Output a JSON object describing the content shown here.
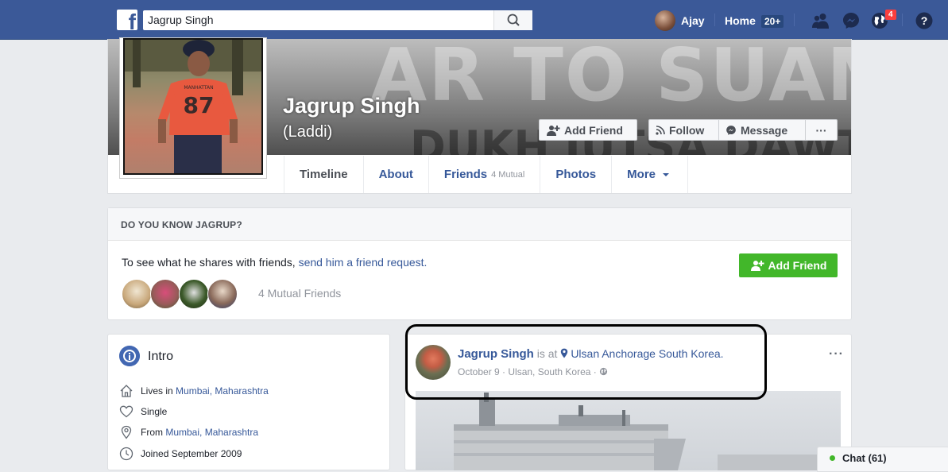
{
  "topbar": {
    "search_value": "Jagrup Singh",
    "user_name": "Ajay",
    "home_label": "Home",
    "home_count": "20+",
    "notification_count": "4"
  },
  "profile": {
    "name": "Jagrup Singh",
    "nickname": "(Laddi)",
    "cover_words": [
      "AR TO SUAMI",
      "DUKH JUTSA DAWT"
    ],
    "shirt_text": "MANHATTAN",
    "shirt_number": "87",
    "actions": {
      "add_friend": "Add Friend",
      "follow": "Follow",
      "message": "Message",
      "more": "···"
    },
    "tabs": [
      {
        "label": "Timeline",
        "extra": ""
      },
      {
        "label": "About",
        "extra": ""
      },
      {
        "label": "Friends",
        "extra": "4 Mutual"
      },
      {
        "label": "Photos",
        "extra": ""
      },
      {
        "label": "More",
        "extra": ""
      }
    ]
  },
  "know": {
    "heading": "DO YOU KNOW JAGRUP?",
    "text": "To see what he shares with friends, ",
    "link": "send him a friend request.",
    "button": "Add Friend",
    "mutual": "4 Mutual Friends"
  },
  "intro": {
    "title": "Intro",
    "lives_prefix": "Lives in ",
    "lives_link": "Mumbai, Maharashtra",
    "relationship": "Single",
    "from_prefix": "From ",
    "from_link": "Mumbai, Maharashtra",
    "joined": "Joined September 2009"
  },
  "post": {
    "author": "Jagrup Singh",
    "is_at": " is at ",
    "location": "Ulsan Anchorage South Korea.",
    "date": "October 9",
    "place": "Ulsan, South Korea",
    "more": "···"
  },
  "chat": {
    "label": "Chat (61)"
  },
  "colors": {
    "brand": "#3b5998",
    "link": "#365899",
    "green": "#42b72a",
    "badge_red": "#fa3e3e"
  },
  "icons": [
    "facebook-logo-icon",
    "search-icon",
    "friends-icon",
    "messenger-icon",
    "globe-icon",
    "help-icon",
    "add-friend-icon",
    "follow-rss-icon",
    "messenger-small-icon",
    "caret-down-icon",
    "intro-globe-icon",
    "home-icon",
    "heart-icon",
    "location-pin-icon",
    "clock-icon",
    "globe-small-icon"
  ]
}
